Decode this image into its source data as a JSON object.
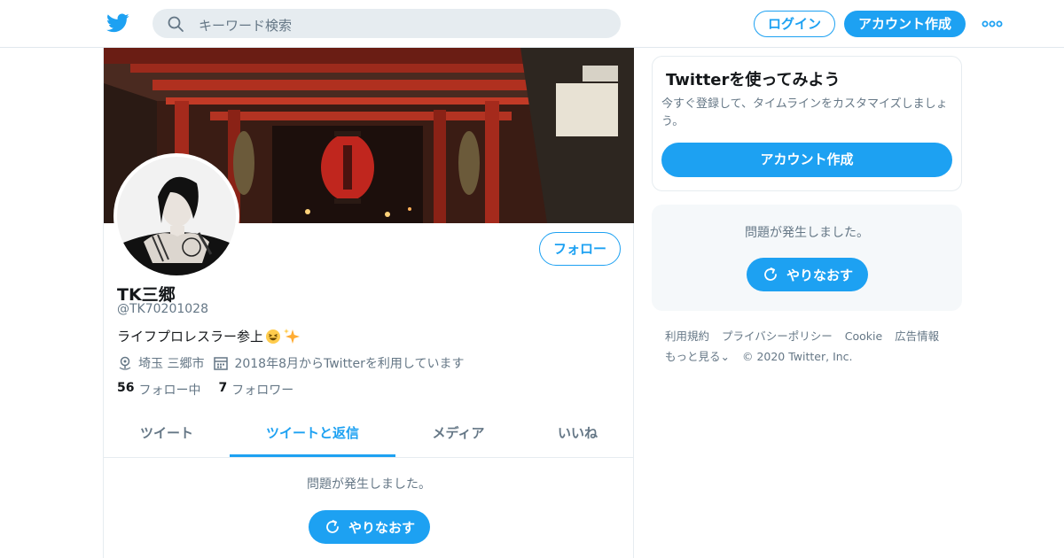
{
  "header": {
    "search_placeholder": "キーワード検索",
    "login_label": "ログイン",
    "signup_label": "アカウント作成"
  },
  "profile": {
    "name": "TK三郷",
    "handle": "@TK70201028",
    "bio": "ライフプロレスラー参上",
    "location": "埼玉 三郷市",
    "joined": "2018年8月からTwitterを利用しています",
    "following_count": "56",
    "following_label": "フォロー中",
    "followers_count": "7",
    "followers_label": "フォロワー",
    "follow_label": "フォロー"
  },
  "tabs": [
    {
      "label": "ツイート"
    },
    {
      "label": "ツイートと返信"
    },
    {
      "label": "メディア"
    },
    {
      "label": "いいね"
    }
  ],
  "timeline": {
    "error_message": "問題が発生しました。",
    "retry_label": "やりなおす"
  },
  "sidebar": {
    "signup_card": {
      "title": "Twitterを使ってみよう",
      "description": "今すぐ登録して、タイムラインをカスタマイズしましょう。",
      "button_label": "アカウント作成"
    },
    "error_card": {
      "message": "問題が発生しました。",
      "retry_label": "やりなおす"
    },
    "footer_links": [
      "利用規約",
      "プライバシーポリシー",
      "Cookie",
      "広告情報",
      "もっと見る⌄",
      "© 2020 Twitter, Inc."
    ]
  },
  "colors": {
    "accent": "#1da1f2",
    "text_primary": "#14171a",
    "text_secondary": "#657786",
    "search_bg": "#e6ecf0",
    "card_bg": "#f5f8fa"
  }
}
